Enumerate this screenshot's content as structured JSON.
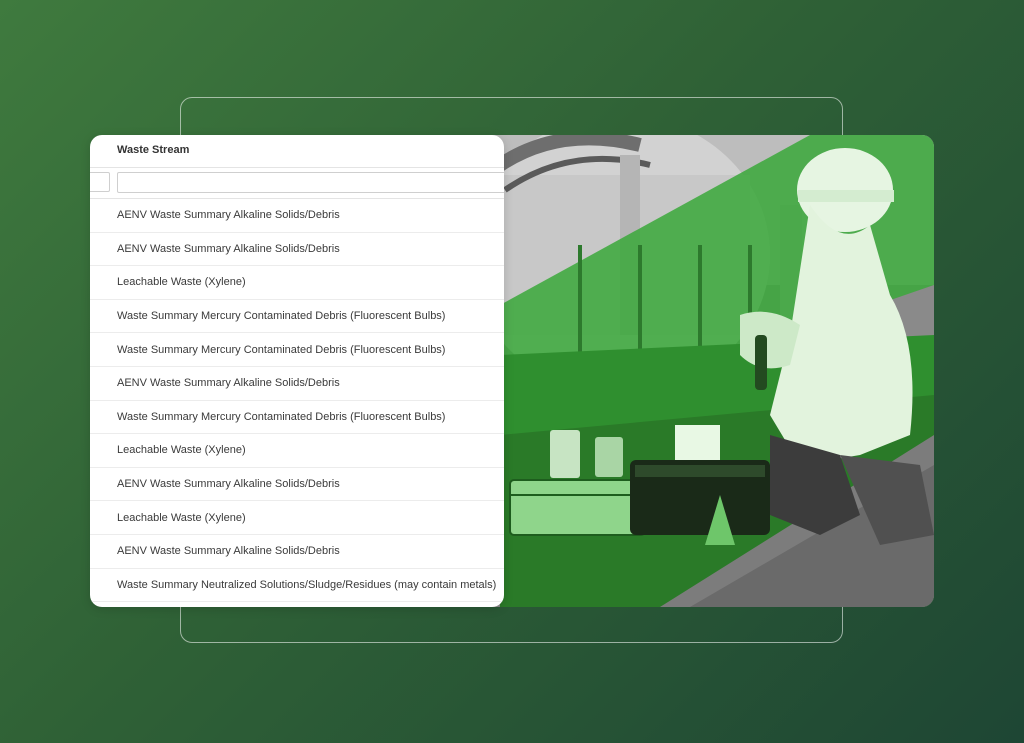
{
  "table": {
    "column_header": "Waste Stream",
    "filter": {
      "value": "",
      "placeholder": ""
    },
    "rows": [
      "AENV Waste Summary Alkaline Solids/Debris",
      "AENV Waste Summary Alkaline Solids/Debris",
      "Leachable Waste (Xylene)",
      "Waste Summary Mercury Contaminated Debris (Fluorescent Bulbs)",
      "Waste Summary Mercury Contaminated Debris (Fluorescent Bulbs)",
      "AENV Waste Summary Alkaline Solids/Debris",
      "Waste Summary Mercury Contaminated Debris (Fluorescent Bulbs)",
      "Leachable Waste (Xylene)",
      "AENV Waste Summary Alkaline Solids/Debris",
      "Leachable Waste (Xylene)",
      "AENV Waste Summary Alkaline Solids/Debris",
      "Waste Summary Neutralized Solutions/Sludge/Residues (may contain metals)"
    ]
  },
  "colors": {
    "background_start": "#3f7a3e",
    "background_end": "#1e4634",
    "accent_green": "#39b039"
  }
}
